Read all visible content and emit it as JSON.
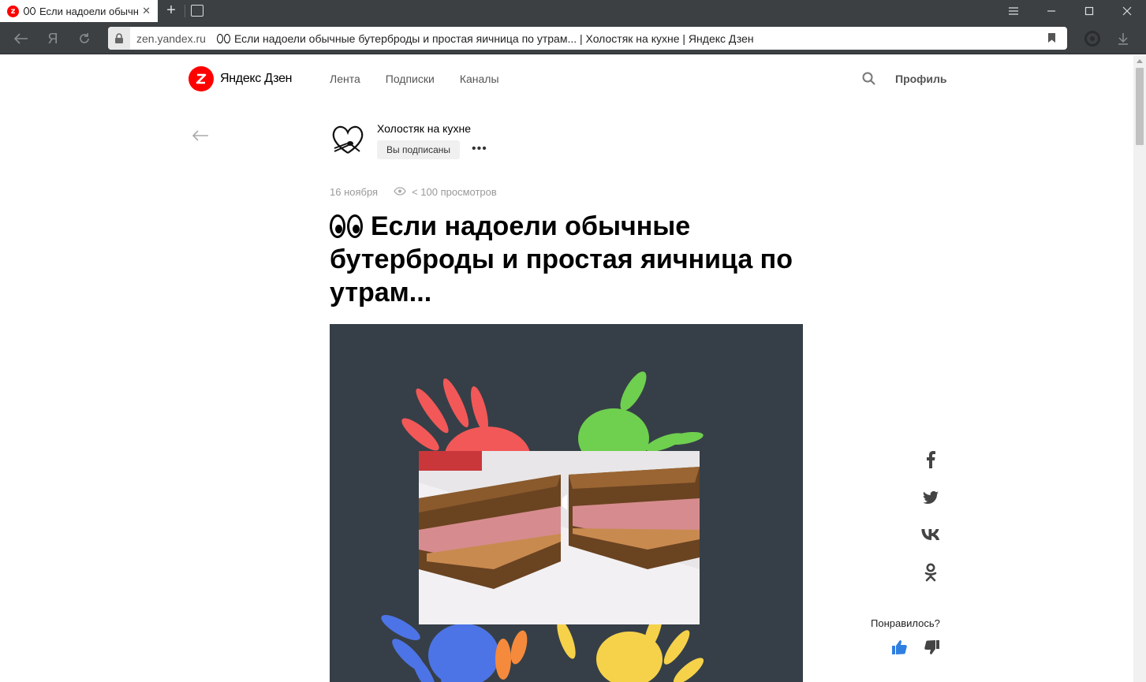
{
  "browser": {
    "tab_title": "Если надоели обычные бутерброды и простая яичница по утрам…",
    "tab_favicon_letter": "z",
    "url_domain": "zen.yandex.ru",
    "url_title": "Если надоели обычные бутерброды и простая яичница по утрам... | Холостяк на кухне | Яндекс Дзен",
    "yandex_button": "Я"
  },
  "header": {
    "logo_text": "Яндекс Дзен",
    "nav": [
      "Лента",
      "Подписки",
      "Каналы"
    ],
    "profile": "Профиль"
  },
  "channel": {
    "name": "Холостяк на кухне",
    "subscribe_state": "Вы подписаны"
  },
  "article": {
    "date": "16 ноября",
    "views": "< 100 просмотров",
    "title": "Если надоели обычные бутерброды и простая яичница по утрам..."
  },
  "sidebar": {
    "social": [
      "facebook-icon",
      "twitter-icon",
      "vk-icon",
      "odnoklassniki-icon"
    ],
    "liked_question": "Понравилось?"
  },
  "colors": {
    "brand_red": "#ff0000",
    "like_blue": "#2f7fe0",
    "hero_bg": "#363f47"
  }
}
